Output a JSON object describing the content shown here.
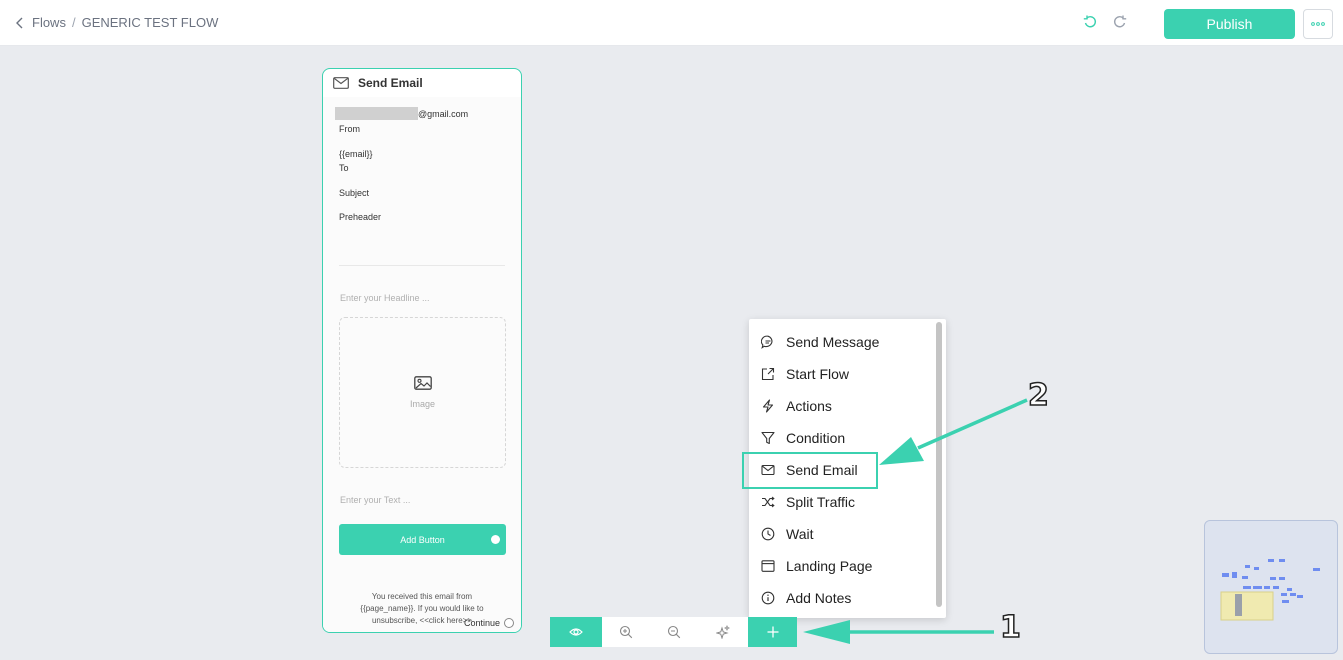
{
  "header": {
    "back_label": "Flows",
    "separator": "/",
    "flow_name": "GENERIC TEST FLOW",
    "publish_label": "Publish"
  },
  "email_card": {
    "title": "Send Email",
    "from_value": "@gmail.com",
    "from_label": "From",
    "to_value": "{{email}}",
    "to_label": "To",
    "subject_label": "Subject",
    "preheader_label": "Preheader",
    "headline_placeholder": "Enter your Headline ...",
    "image_label": "Image",
    "text_placeholder": "Enter your Text ...",
    "add_button_label": "Add Button",
    "footer_text": "You received this email from {{page_name}}. If you would like to unsubscribe, <<click here>>",
    "continue_label": "Continue"
  },
  "menu": {
    "items": [
      {
        "label": "Send Message",
        "icon": "message-icon"
      },
      {
        "label": "Start Flow",
        "icon": "external-link-icon"
      },
      {
        "label": "Actions",
        "icon": "lightning-icon"
      },
      {
        "label": "Condition",
        "icon": "filter-icon"
      },
      {
        "label": "Send Email",
        "icon": "mail-icon"
      },
      {
        "label": "Split Traffic",
        "icon": "shuffle-icon"
      },
      {
        "label": "Wait",
        "icon": "clock-icon"
      },
      {
        "label": "Landing Page",
        "icon": "browser-icon"
      },
      {
        "label": "Add Notes",
        "icon": "info-icon"
      }
    ],
    "highlighted": "Send Email"
  },
  "toolbar": {
    "buttons": [
      "eye-icon",
      "zoom-in-icon",
      "zoom-out-icon",
      "fit-view-icon",
      "plus-icon"
    ]
  },
  "annotations": {
    "step_1": "1",
    "step_2": "2"
  },
  "colors": {
    "accent": "#3bd1b0",
    "canvas": "#e9ebef",
    "minimap": "#dde3ef"
  }
}
